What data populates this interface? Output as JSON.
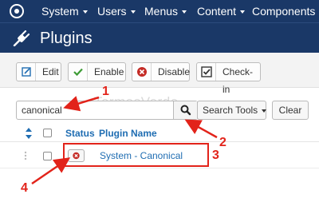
{
  "topbar": {
    "logo_icon": "joomla-logo-icon",
    "menus": [
      {
        "label": "System"
      },
      {
        "label": "Users"
      },
      {
        "label": "Menus"
      },
      {
        "label": "Content"
      },
      {
        "label": "Components"
      }
    ]
  },
  "header": {
    "title": "Plugins",
    "icon": "plug-icon"
  },
  "toolbar": {
    "edit": "Edit",
    "enable": "Enable",
    "disable": "Disable",
    "checkin": "Check-in"
  },
  "filter": {
    "search_value": "canonical",
    "search_tools": "Search Tools",
    "clear": "Clear"
  },
  "watermark": "TermasVerde",
  "table": {
    "headers": {
      "status": "Status",
      "name": "Plugin Name"
    },
    "rows": [
      {
        "name": "System - Canonical",
        "status": "disabled"
      }
    ]
  },
  "annotations": [
    "1",
    "2",
    "3",
    "4"
  ],
  "colors": {
    "navbar": "#1a3867",
    "link": "#1f6db2",
    "annotation": "#e2231a"
  }
}
